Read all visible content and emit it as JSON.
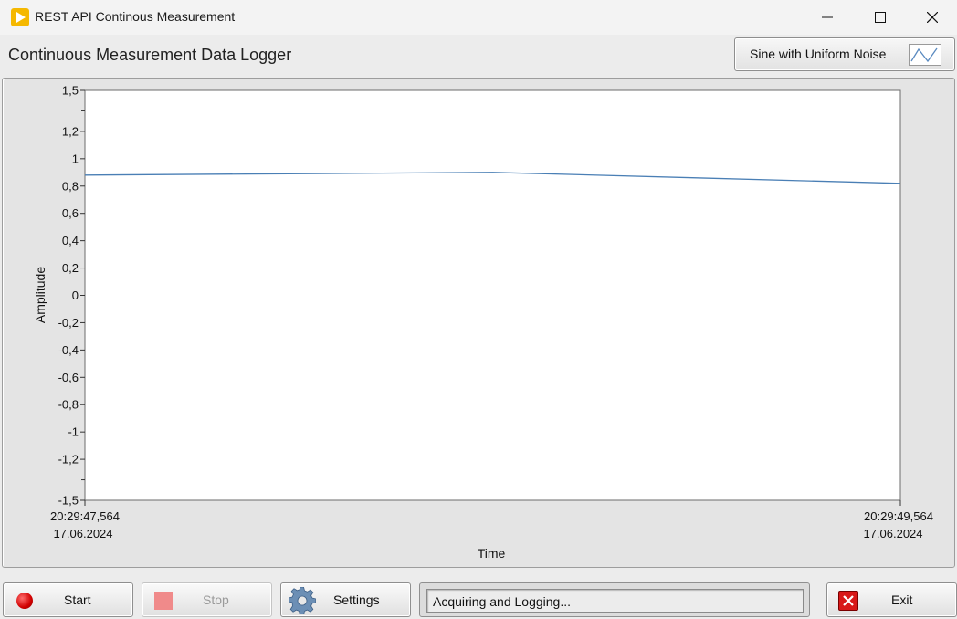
{
  "window": {
    "title": "REST API Continous Measurement",
    "controls": {
      "minimize": "minimize-icon",
      "maximize": "maximize-icon",
      "close": "close-icon"
    }
  },
  "header": {
    "title": "Continuous Measurement Data Logger",
    "signal_type": "Sine with Uniform Noise"
  },
  "chart_data": {
    "type": "line",
    "title": "",
    "xlabel": "Time",
    "ylabel": "Amplitude",
    "ylim": [
      -1.5,
      1.5
    ],
    "y_ticks": [
      "1,5",
      "1,2",
      "1",
      "0,8",
      "0,6",
      "0,4",
      "0,2",
      "0",
      "-0,2",
      "-0,4",
      "-0,6",
      "-0,8",
      "-1",
      "-1,2",
      "-1,5"
    ],
    "x_tick_labels": [
      {
        "time": "20:29:47,564",
        "date": "17.06.2024"
      },
      {
        "time": "20:29:49,564",
        "date": "17.06.2024"
      }
    ],
    "grid": false,
    "line_color": "#4a7fb5",
    "series": [
      {
        "x": [
          0,
          0.25,
          0.5,
          0.75,
          1.0
        ],
        "values": [
          0.88,
          0.89,
          0.9,
          0.86,
          0.82
        ]
      }
    ]
  },
  "buttons": {
    "start": "Start",
    "stop": "Stop",
    "settings": "Settings",
    "exit": "Exit"
  },
  "status": "Acquiring and Logging...",
  "colors": {
    "accent": "#f5b800",
    "start_red": "#d10000",
    "exit_red": "#d81818",
    "plot_line": "#4a7fb5"
  }
}
